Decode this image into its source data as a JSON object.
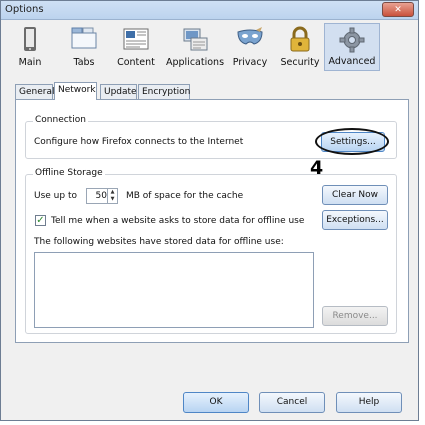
{
  "window": {
    "title": "Options",
    "close_glyph": "✕"
  },
  "toolbar": {
    "items": [
      {
        "label": "Main",
        "icon": "main-icon"
      },
      {
        "label": "Tabs",
        "icon": "tabs-icon"
      },
      {
        "label": "Content",
        "icon": "content-icon"
      },
      {
        "label": "Applications",
        "icon": "applications-icon"
      },
      {
        "label": "Privacy",
        "icon": "privacy-mask-icon"
      },
      {
        "label": "Security",
        "icon": "padlock-icon"
      },
      {
        "label": "Advanced",
        "icon": "gear-icon",
        "selected": true
      }
    ]
  },
  "tabs": [
    {
      "label": "General"
    },
    {
      "label": "Network",
      "active": true
    },
    {
      "label": "Update"
    },
    {
      "label": "Encryption"
    }
  ],
  "connection": {
    "legend": "Connection",
    "description": "Configure how Firefox connects to the Internet",
    "settings_button": "Settings..."
  },
  "offline": {
    "legend": "Offline Storage",
    "use_up_to": "Use up to",
    "cache_size": "50",
    "cache_unit": "MB of space for the cache",
    "clear_now_button": "Clear Now",
    "tell_me_label": "Tell me when a website asks to store data for offline use",
    "tell_me_checked": true,
    "exceptions_button": "Exceptions...",
    "sites_label": "The following websites have stored data for offline use:",
    "remove_button": "Remove..."
  },
  "annotation": {
    "step_number": "4"
  },
  "footer": {
    "ok": "OK",
    "cancel": "Cancel",
    "help": "Help"
  },
  "colors": {
    "accent": "#4f86c6",
    "selected_tab": "#d2dff0",
    "checkmark": "#2f8a2f"
  }
}
